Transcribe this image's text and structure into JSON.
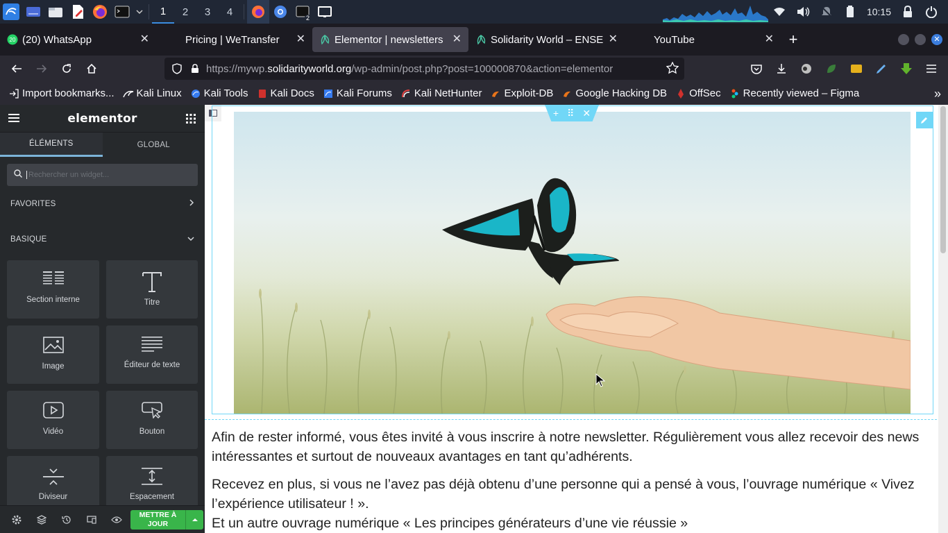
{
  "taskbar": {
    "workspaces": [
      "1",
      "2",
      "3",
      "4"
    ],
    "active_workspace": "1",
    "clock": "10:15",
    "terminal_badge": "2"
  },
  "tabs": [
    {
      "title": "(20) WhatsApp",
      "badge": "20",
      "active": false
    },
    {
      "title": "Pricing | WeTransfer",
      "active": false
    },
    {
      "title": "Elementor | newsletters",
      "active": true
    },
    {
      "title": "Solidarity World – ENSEM",
      "active": false
    },
    {
      "title": "YouTube",
      "active": false
    }
  ],
  "navbar": {
    "url_prefix": "https://mywp.",
    "url_domain": "solidarityworld.org",
    "url_path": "/wp-admin/post.php?post=100000870&action=elementor"
  },
  "bookmarks": [
    {
      "label": "Import bookmarks...",
      "icon": "import-icon"
    },
    {
      "label": "Kali Linux",
      "icon": "kali-dragon-icon"
    },
    {
      "label": "Kali Tools",
      "icon": "kali-tools-icon"
    },
    {
      "label": "Kali Docs",
      "icon": "kali-docs-icon"
    },
    {
      "label": "Kali Forums",
      "icon": "kali-forums-icon"
    },
    {
      "label": "Kali NetHunter",
      "icon": "nethunter-icon"
    },
    {
      "label": "Exploit-DB",
      "icon": "exploit-db-icon"
    },
    {
      "label": "Google Hacking DB",
      "icon": "ghdb-icon"
    },
    {
      "label": "OffSec",
      "icon": "offsec-icon"
    },
    {
      "label": "Recently viewed – Figma",
      "icon": "figma-icon"
    }
  ],
  "panel": {
    "logo": "elementor",
    "tabs": [
      "ÉLÉMENTS",
      "GLOBAL"
    ],
    "search_placeholder": "Rechercher un widget...",
    "categories": {
      "favorites": "FAVORITES",
      "basic": "BASIQUE"
    },
    "widgets": [
      {
        "label": "Section interne",
        "icon": "inner-section-icon"
      },
      {
        "label": "Titre",
        "icon": "heading-icon"
      },
      {
        "label": "Image",
        "icon": "image-icon"
      },
      {
        "label": "Éditeur de texte",
        "icon": "text-editor-icon"
      },
      {
        "label": "Vidéo",
        "icon": "video-icon"
      },
      {
        "label": "Bouton",
        "icon": "button-icon"
      },
      {
        "label": "Diviseur",
        "icon": "divider-icon"
      },
      {
        "label": "Espacement",
        "icon": "spacer-icon"
      }
    ],
    "update_button": "METTRE À JOUR"
  },
  "canvas": {
    "paragraphs": [
      "Afin de rester informé, vous êtes invité à vous inscrire à notre newsletter. Régulièrement vous allez recevoir des news intéressantes et surtout de nouveaux avantages en tant qu’adhérents.",
      "Recevez en plus, si vous ne l’avez pas déjà obtenu d’une personne qui a pensé à vous, l’ouvrage numérique « Vivez l’expérience utilisateur ! ».",
      "Et un autre ouvrage numérique « Les principes générateurs d’une vie réussie »"
    ]
  },
  "colors": {
    "elementor_accent": "#71d7f7",
    "update_green": "#39b54a",
    "panel_bg": "#26292c"
  }
}
